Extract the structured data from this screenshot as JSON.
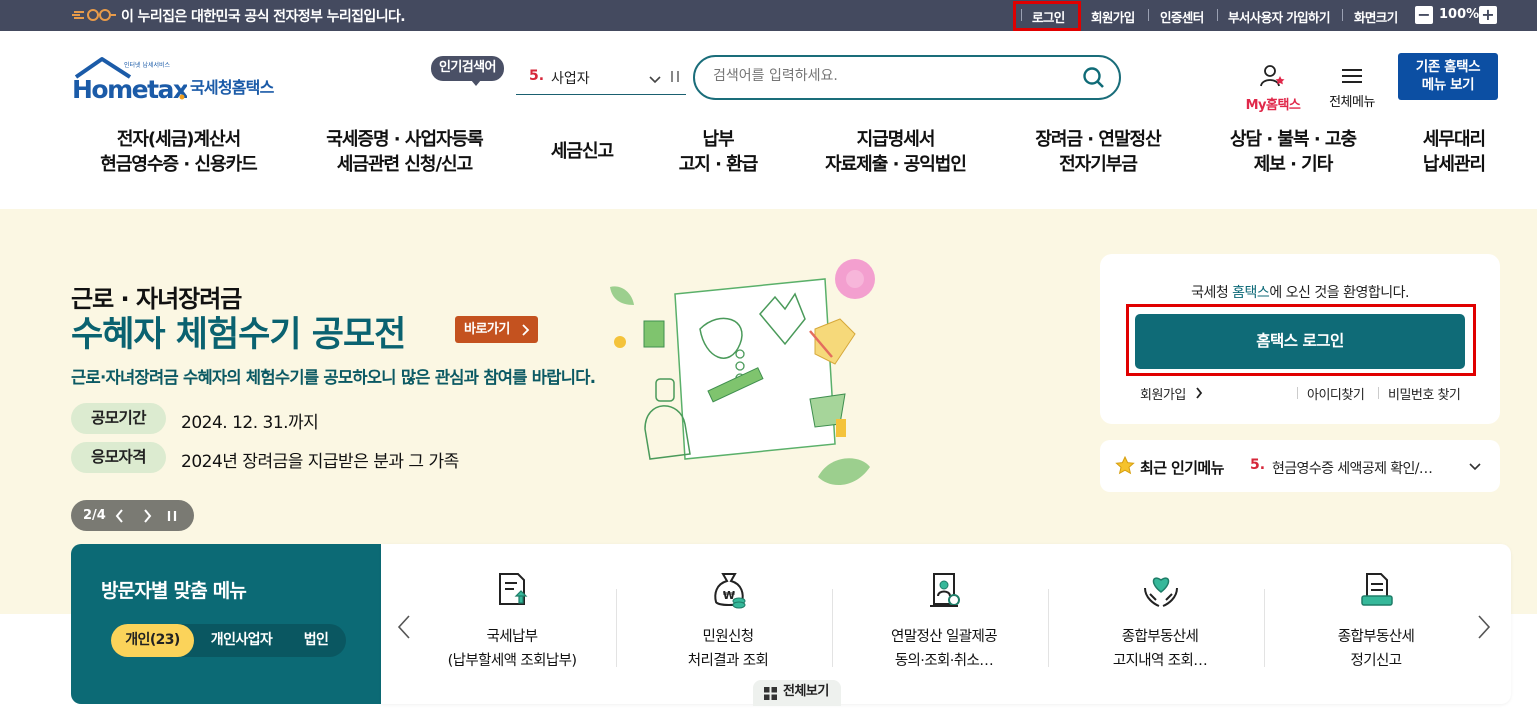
{
  "gov_bar": {
    "notice": "이 누리집은 대한민국 공식 전자정부 누리집입니다.",
    "links": [
      "로그인",
      "회원가입",
      "인증센터",
      "부서사용자 가입하기",
      "화면크기"
    ],
    "zoom": "100%",
    "zoom_minus": "−",
    "zoom_plus": "+"
  },
  "header": {
    "logo_main": "Hometax",
    "logo_tagline": "인터넷 납세서비스",
    "logo_sub": "국세청홈택스",
    "popular_badge": "인기검색어",
    "popular_rank": "5.",
    "popular_term": "사업자",
    "search_placeholder": "검색어를 입력하세요.",
    "my_label": "My홈택스",
    "all_menu_label": "전체메뉴",
    "old_menu_line1": "기존 홈택스",
    "old_menu_line2": "메뉴 보기"
  },
  "gnb": [
    {
      "l1": "전자(세금)계산서",
      "l2": "현금영수증 · 신용카드"
    },
    {
      "l1": "국세증명 · 사업자등록",
      "l2": "세금관련 신청/신고"
    },
    {
      "l1": "세금신고",
      "l2": ""
    },
    {
      "l1": "납부",
      "l2": "고지 · 환급"
    },
    {
      "l1": "지급명세서",
      "l2": "자료제출 · 공익법인"
    },
    {
      "l1": "장려금 · 연말정산",
      "l2": "전자기부금"
    },
    {
      "l1": "상담 · 불복 · 고충",
      "l2": "제보 · 기타"
    },
    {
      "l1": "세무대리",
      "l2": "납세관리"
    }
  ],
  "banner": {
    "subtitle": "근로 · 자녀장려금",
    "title": "수혜자 체험수기 공모전",
    "go_button": "바로가기",
    "description": "근로·자녀장려금 수혜자의 체험수기를 공모하오니 많은 관심과 참여를 바랍니다.",
    "period_label": "공모기간",
    "period_value": "2024. 12. 31.까지",
    "qual_label": "응모자격",
    "qual_value": "2024년 장려금을 지급받은 분과 그 가족",
    "pager": "2/4"
  },
  "welcome": {
    "text_pre": "국세청 ",
    "text_highlight": "홈택스",
    "text_post": "에 오신 것을 환영합니다.",
    "login_button": "홈택스 로그인",
    "signup": "회원가입",
    "find_id": "아이디찾기",
    "find_pw": "비밀번호 찾기"
  },
  "recent": {
    "label": "최근 인기메뉴",
    "rank": "5.",
    "item": "현금영수증 세액공제 확인/…"
  },
  "visitor": {
    "title": "방문자별 맞춤 메뉴",
    "tabs": [
      "개인(23)",
      "개인사업자",
      "법인"
    ]
  },
  "quick_menu": [
    {
      "l1": "국세납부",
      "l2": "(납부할세액 조회납부)",
      "icon": "tax-payment-icon"
    },
    {
      "l1": "민원신청",
      "l2": "처리결과 조회",
      "icon": "money-bag-icon"
    },
    {
      "l1": "연말정산 일괄제공",
      "l2": "동의·조회·취소…",
      "icon": "year-end-document-icon"
    },
    {
      "l1": "종합부동산세",
      "l2": "고지내역 조회…",
      "icon": "heart-hands-icon"
    },
    {
      "l1": "종합부동산세",
      "l2": "정기신고",
      "icon": "report-document-icon"
    }
  ],
  "view_all": "전체보기",
  "colors": {
    "teal": "#0f6b77",
    "gov_bar": "#444a5f",
    "banner_bg": "#fbf7e3",
    "accent_red": "#d6273a",
    "highlight_box": "#e00000"
  }
}
